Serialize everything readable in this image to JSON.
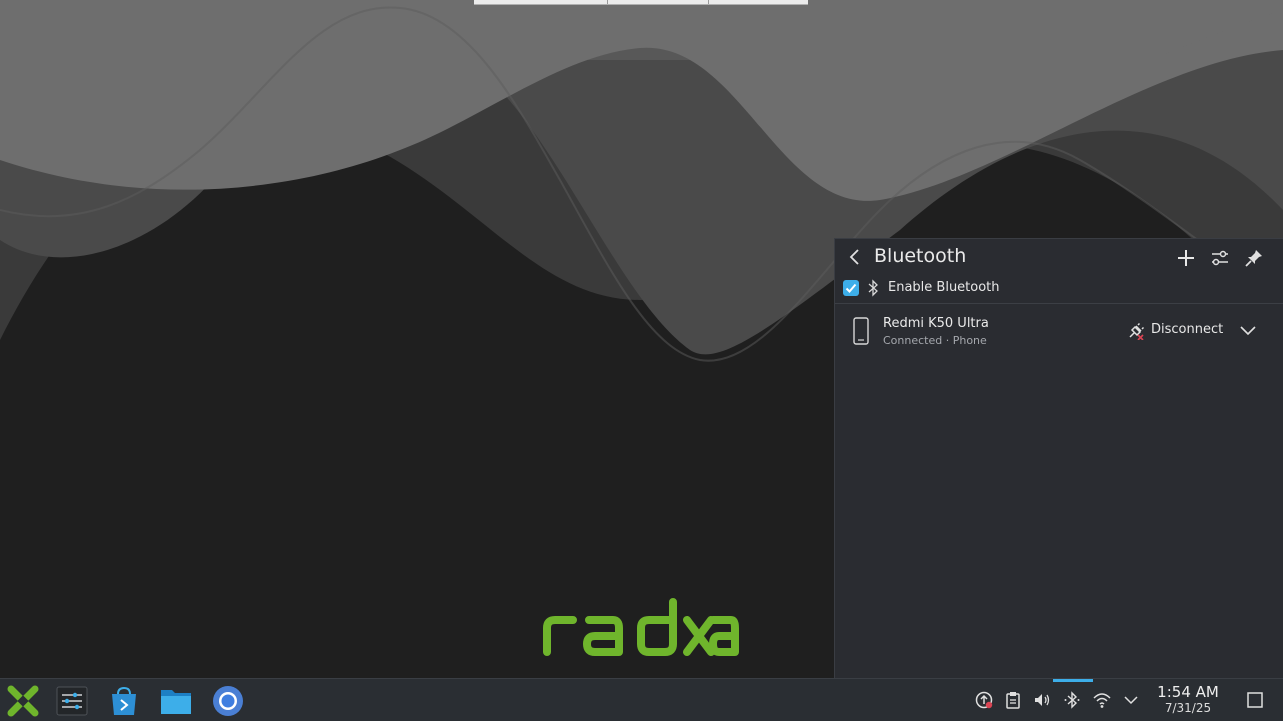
{
  "bluetooth_panel": {
    "title": "Bluetooth",
    "enable_label": "Enable Bluetooth",
    "enabled": true,
    "devices": [
      {
        "name": "Redmi K50 Ultra",
        "status": "Connected · Phone",
        "action_label": "Disconnect",
        "icon": "smartphone-icon"
      }
    ]
  },
  "desktop": {
    "logo_text": "radxa",
    "logo_color": "#6fb52c"
  },
  "taskbar": {
    "launchers": [
      "app-launcher-icon",
      "system-settings-icon",
      "discover-store-icon",
      "file-manager-icon",
      "chromium-browser-icon"
    ],
    "tray": [
      "update-notification-icon",
      "clipboard-icon",
      "volume-icon",
      "bluetooth-icon",
      "wifi-icon",
      "expand-tray-icon"
    ],
    "clock": {
      "time": "1:54 AM",
      "date": "7/31/25"
    }
  },
  "colors": {
    "accent": "#3daee9",
    "panel_bg": "#2a2c31",
    "taskbar_bg": "#2a2e33"
  }
}
